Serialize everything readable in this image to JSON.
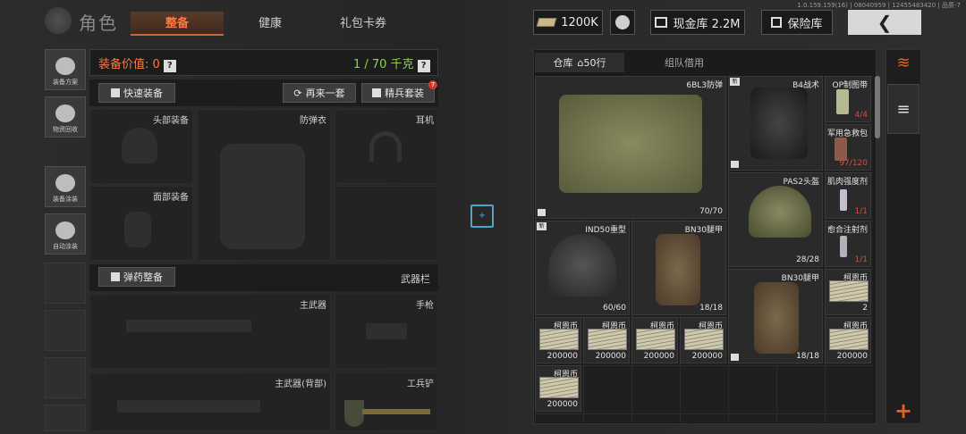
{
  "version": "1.0.159.159(16) | 08040959 | 12455483420 | 品质-7",
  "title": "角色",
  "tabs": [
    "整备",
    "健康",
    "礼包卡券"
  ],
  "currency": "1200K",
  "cash_vault": "现金库 2.2M",
  "safe": "保险库",
  "left_nav": [
    "装备方案",
    "物资回收",
    "装备涂装",
    "自动涂装"
  ],
  "equip": {
    "value_label": "装备价值: 0",
    "weight": "1 / 70 千克",
    "quick": "快速装备",
    "again": "再来一套",
    "elite": "精兵套装",
    "elite_badge": "7"
  },
  "slots": {
    "head": "头部装备",
    "armor": "防弹衣",
    "ear": "耳机",
    "face": "面部装备",
    "ammo": "弹药整备",
    "weapon_bar": "武器栏",
    "primary": "主武器",
    "pistol": "手枪",
    "primary_back": "主武器(背部)",
    "shovel": "工兵铲"
  },
  "inventory": {
    "tab_warehouse": "仓库",
    "rows": "50行",
    "tab_team": "组队借用"
  },
  "items": {
    "armor6bl3": {
      "name": "6BL3防弹",
      "count": "70/70"
    },
    "b4": {
      "name": "B4战术"
    },
    "op": {
      "name": "OP制图带",
      "count": "4/4"
    },
    "kit": {
      "name": "军用急救包",
      "count": "97/120"
    },
    "pas2": {
      "name": "PAS2头盔",
      "count": "28/28"
    },
    "muscle": {
      "name": "肌肉强度剂",
      "count": "1/1"
    },
    "ind50": {
      "name": "IND50重型",
      "count": "60/60"
    },
    "bn30a": {
      "name": "BN30腿甲",
      "count": "18/18"
    },
    "heal": {
      "name": "愈合注射剂",
      "count": "1/1"
    },
    "bn30b": {
      "name": "BN30腿甲",
      "count": "18/18"
    },
    "coin_side": {
      "name": "柯恩币",
      "count": "2"
    },
    "coins": [
      {
        "name": "柯恩币",
        "count": "200000"
      },
      {
        "name": "柯恩币",
        "count": "200000"
      },
      {
        "name": "柯恩币",
        "count": "200000"
      },
      {
        "name": "柯恩币",
        "count": "200000"
      },
      {
        "name": "柯恩币",
        "count": "200000"
      },
      {
        "name": "柯恩币",
        "count": "200000"
      }
    ]
  },
  "new_label": "新",
  "colors": {
    "accent": "#e0622a",
    "green": "#8fd14f",
    "bg": "#2a2a2a"
  }
}
